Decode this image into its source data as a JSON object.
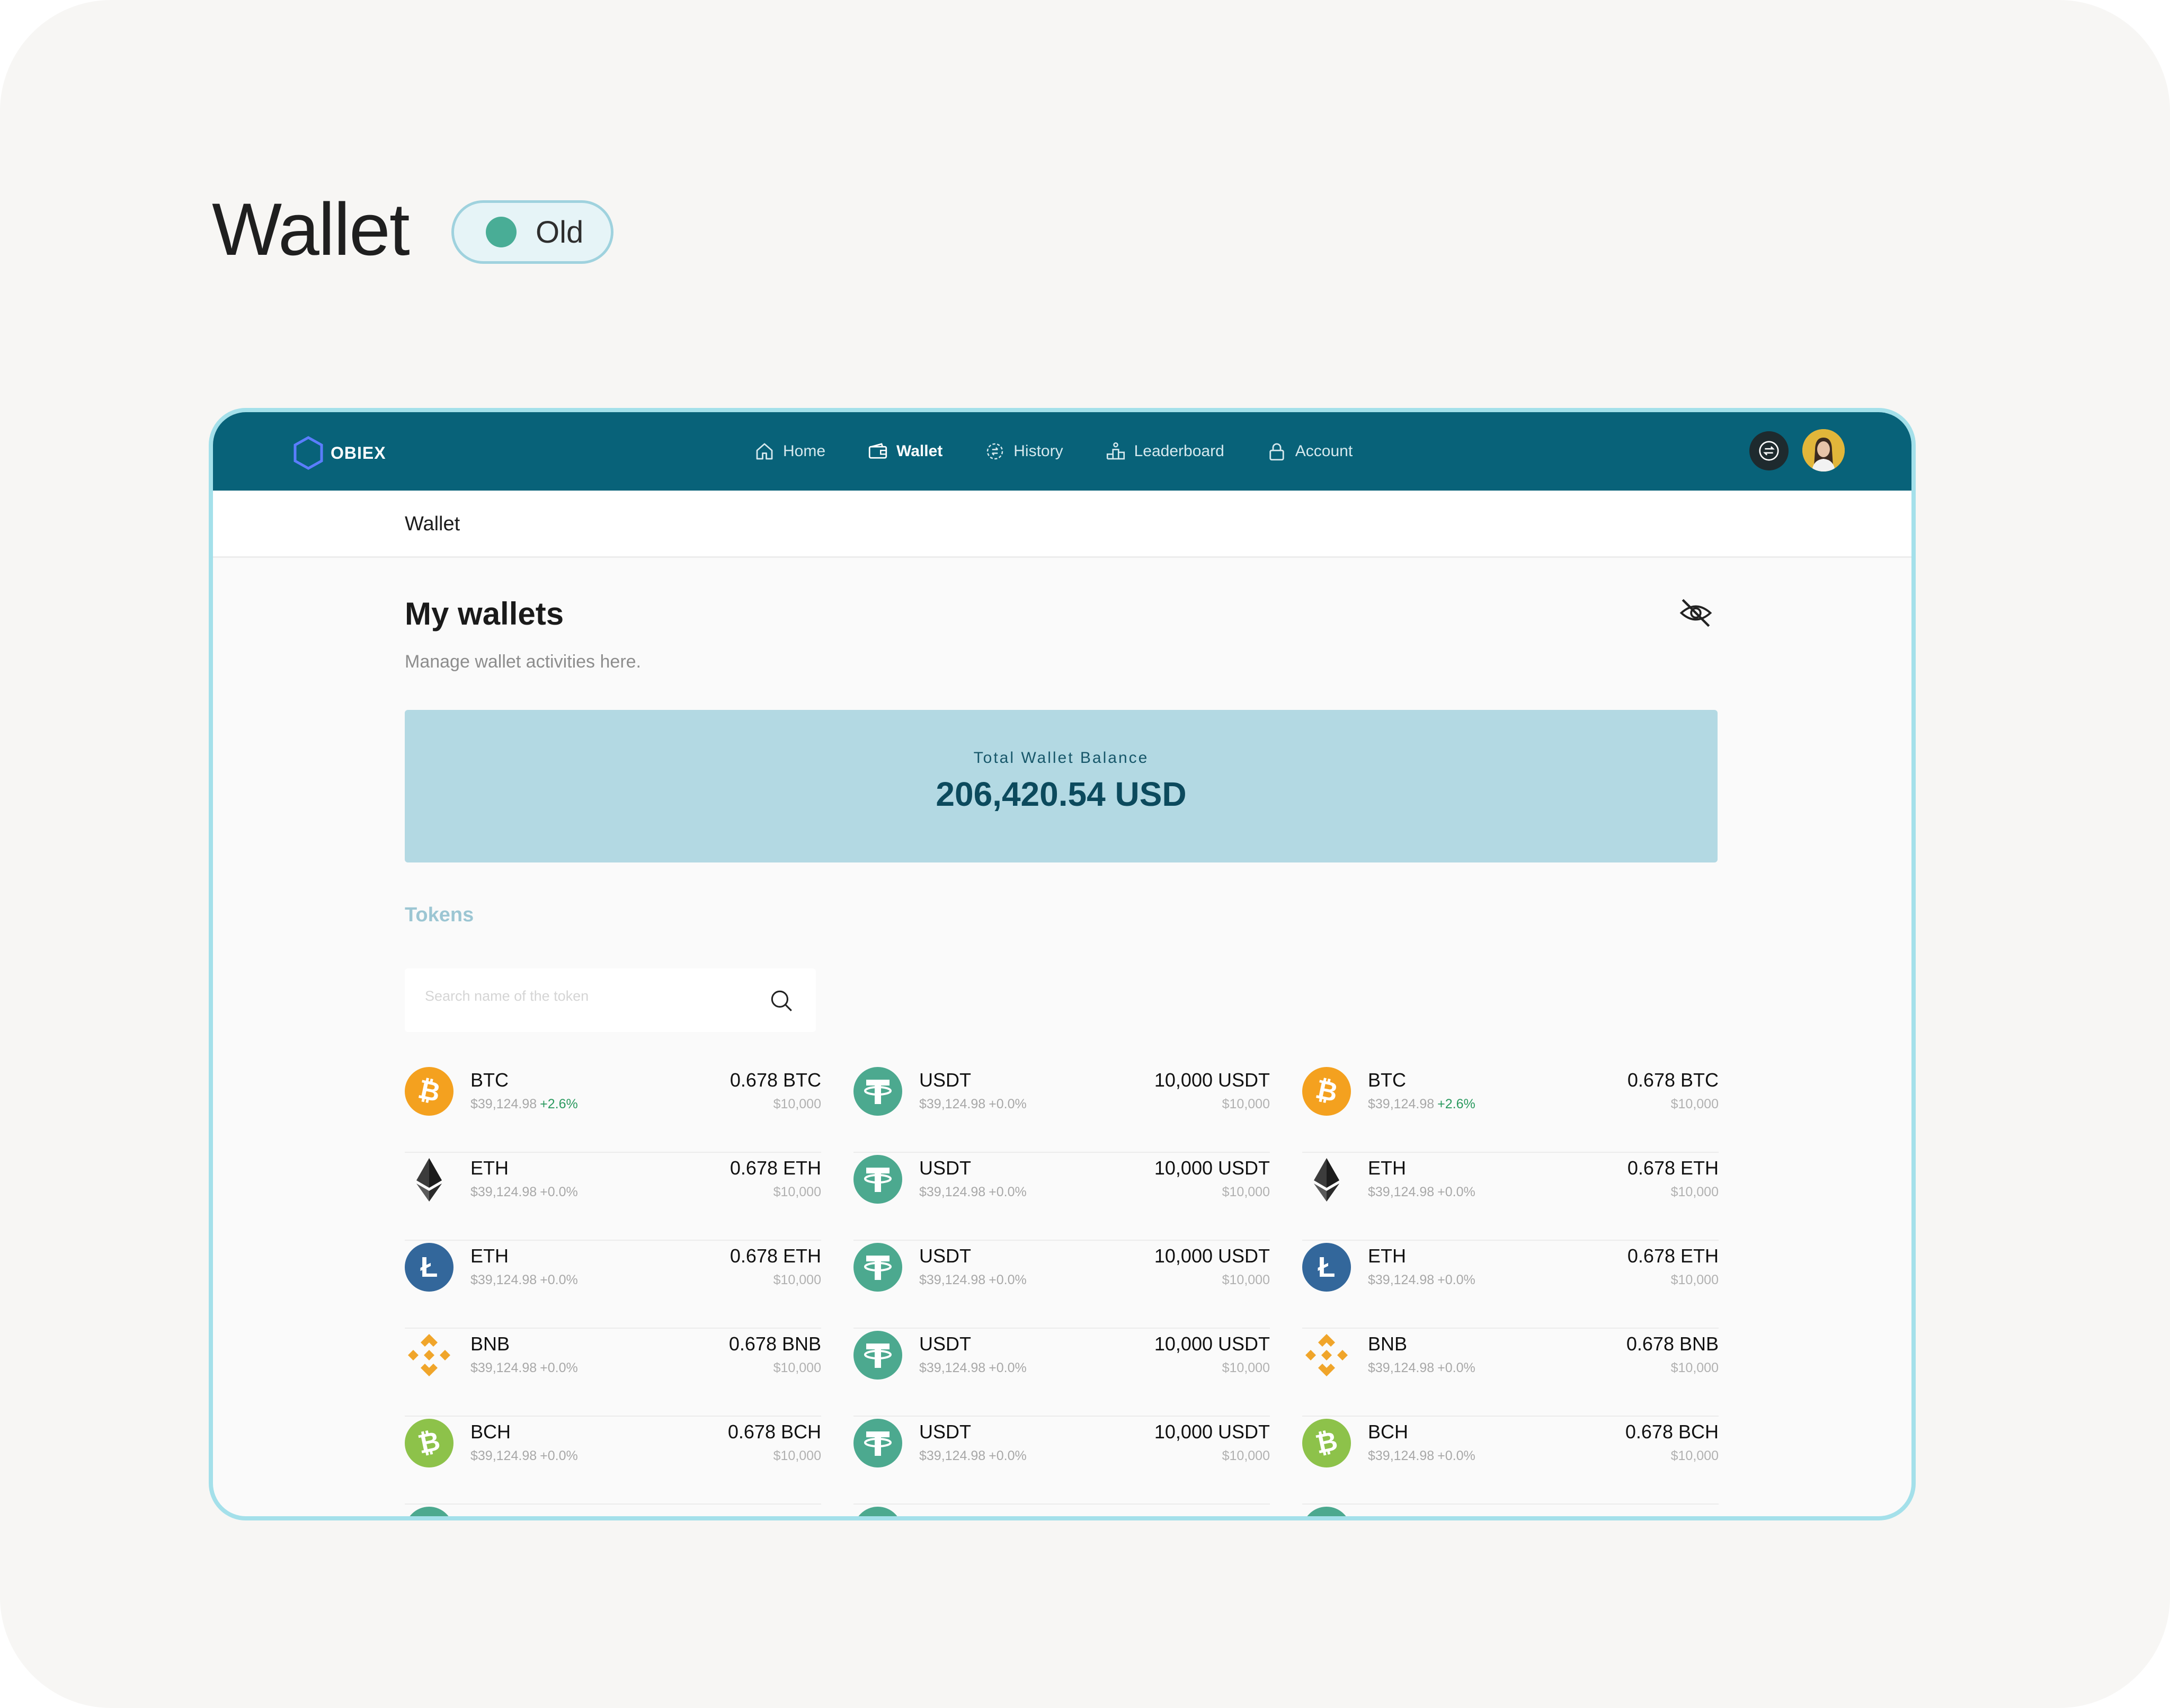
{
  "page": {
    "title": "Wallet",
    "status_label": "Old"
  },
  "app": {
    "brand": "OBIEX",
    "nav": [
      {
        "label": "Home",
        "icon": "home-icon"
      },
      {
        "label": "Wallet",
        "icon": "wallet-icon",
        "active": true
      },
      {
        "label": "History",
        "icon": "history-icon"
      },
      {
        "label": "Leaderboard",
        "icon": "leaderboard-icon"
      },
      {
        "label": "Account",
        "icon": "lock-icon"
      }
    ],
    "colors": {
      "header": "#086279",
      "balance_card": "#b3d9e3",
      "positive": "#2b9a5f"
    }
  },
  "breadcrumb": "Wallet",
  "main": {
    "title": "My wallets",
    "subtitle": "Manage wallet activities here.",
    "balance_label": "Total Wallet Balance",
    "balance_value": "206,420.54 USD",
    "section_label": "Tokens",
    "search_placeholder": "Search name of the token"
  },
  "tokens": {
    "col1": [
      {
        "name": "BTC",
        "price": "$39,124.98",
        "change": "+2.6%",
        "amount": "0.678 BTC",
        "usd": "$10,000",
        "icon": "bitcoin-icon"
      },
      {
        "name": "ETH",
        "price": "$39,124.98",
        "change": "+0.0%",
        "amount": "0.678 ETH",
        "usd": "$10,000",
        "icon": "ethereum-icon"
      },
      {
        "name": "ETH",
        "price": "$39,124.98",
        "change": "+0.0%",
        "amount": "0.678 ETH",
        "usd": "$10,000",
        "icon": "litecoin-icon"
      },
      {
        "name": "BNB",
        "price": "$39,124.98",
        "change": "+0.0%",
        "amount": "0.678 BNB",
        "usd": "$10,000",
        "icon": "bnb-icon"
      },
      {
        "name": "BCH",
        "price": "$39,124.98",
        "change": "+0.0%",
        "amount": "0.678 BCH",
        "usd": "$10,000",
        "icon": "bitcoin-cash-icon"
      }
    ],
    "col2": [
      {
        "name": "USDT",
        "price": "$39,124.98",
        "change": "+0.0%",
        "amount": "10,000 USDT",
        "usd": "$10,000",
        "icon": "tether-icon"
      },
      {
        "name": "USDT",
        "price": "$39,124.98",
        "change": "+0.0%",
        "amount": "10,000 USDT",
        "usd": "$10,000",
        "icon": "tether-icon"
      },
      {
        "name": "USDT",
        "price": "$39,124.98",
        "change": "+0.0%",
        "amount": "10,000 USDT",
        "usd": "$10,000",
        "icon": "tether-icon"
      },
      {
        "name": "USDT",
        "price": "$39,124.98",
        "change": "+0.0%",
        "amount": "10,000 USDT",
        "usd": "$10,000",
        "icon": "tether-icon"
      },
      {
        "name": "USDT",
        "price": "$39,124.98",
        "change": "+0.0%",
        "amount": "10,000 USDT",
        "usd": "$10,000",
        "icon": "tether-icon"
      }
    ],
    "col3": [
      {
        "name": "BTC",
        "price": "$39,124.98",
        "change": "+2.6%",
        "amount": "0.678 BTC",
        "usd": "$10,000",
        "icon": "bitcoin-icon"
      },
      {
        "name": "ETH",
        "price": "$39,124.98",
        "change": "+0.0%",
        "amount": "0.678 ETH",
        "usd": "$10,000",
        "icon": "ethereum-icon"
      },
      {
        "name": "ETH",
        "price": "$39,124.98",
        "change": "+0.0%",
        "amount": "0.678 ETH",
        "usd": "$10,000",
        "icon": "litecoin-icon"
      },
      {
        "name": "BNB",
        "price": "$39,124.98",
        "change": "+0.0%",
        "amount": "0.678 BNB",
        "usd": "$10,000",
        "icon": "bnb-icon"
      },
      {
        "name": "BCH",
        "price": "$39,124.98",
        "change": "+0.0%",
        "amount": "0.678 BCH",
        "usd": "$10,000",
        "icon": "bitcoin-cash-icon"
      }
    ]
  }
}
